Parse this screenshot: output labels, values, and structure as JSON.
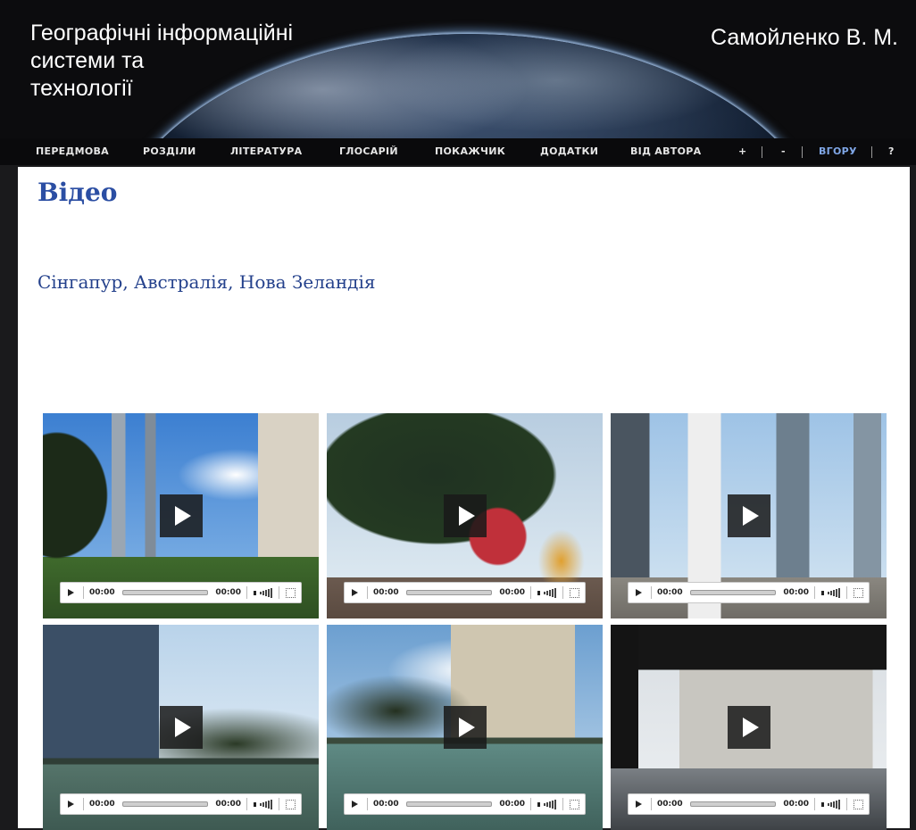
{
  "header": {
    "title": "Географічні інформаційні\nсистеми та\nтехнології",
    "author": "Самойленко В. М."
  },
  "nav": {
    "items": [
      "ПЕРЕДМОВА",
      "РОЗДІЛИ",
      "ЛІТЕРАТУРА",
      "ГЛОСАРІЙ",
      "ПОКАЖЧИК",
      "ДОДАТКИ",
      "ВІД АВТОРА",
      "+",
      "-",
      "ВГОРУ",
      "?"
    ]
  },
  "page": {
    "title": "Відео",
    "subtitle": "Сінгапур, Австралія, Нова Зеландія"
  },
  "videos": [
    {
      "current_time": "00:00",
      "duration": "00:00"
    },
    {
      "current_time": "00:00",
      "duration": "00:00"
    },
    {
      "current_time": "00:00",
      "duration": "00:00"
    },
    {
      "current_time": "00:00",
      "duration": "00:00"
    },
    {
      "current_time": "00:00",
      "duration": "00:00"
    },
    {
      "current_time": "00:00",
      "duration": "00:00"
    }
  ],
  "colors": {
    "background": "#1a1a1c",
    "accent": "#2b4ea3",
    "content_bg": "#ffffff"
  }
}
